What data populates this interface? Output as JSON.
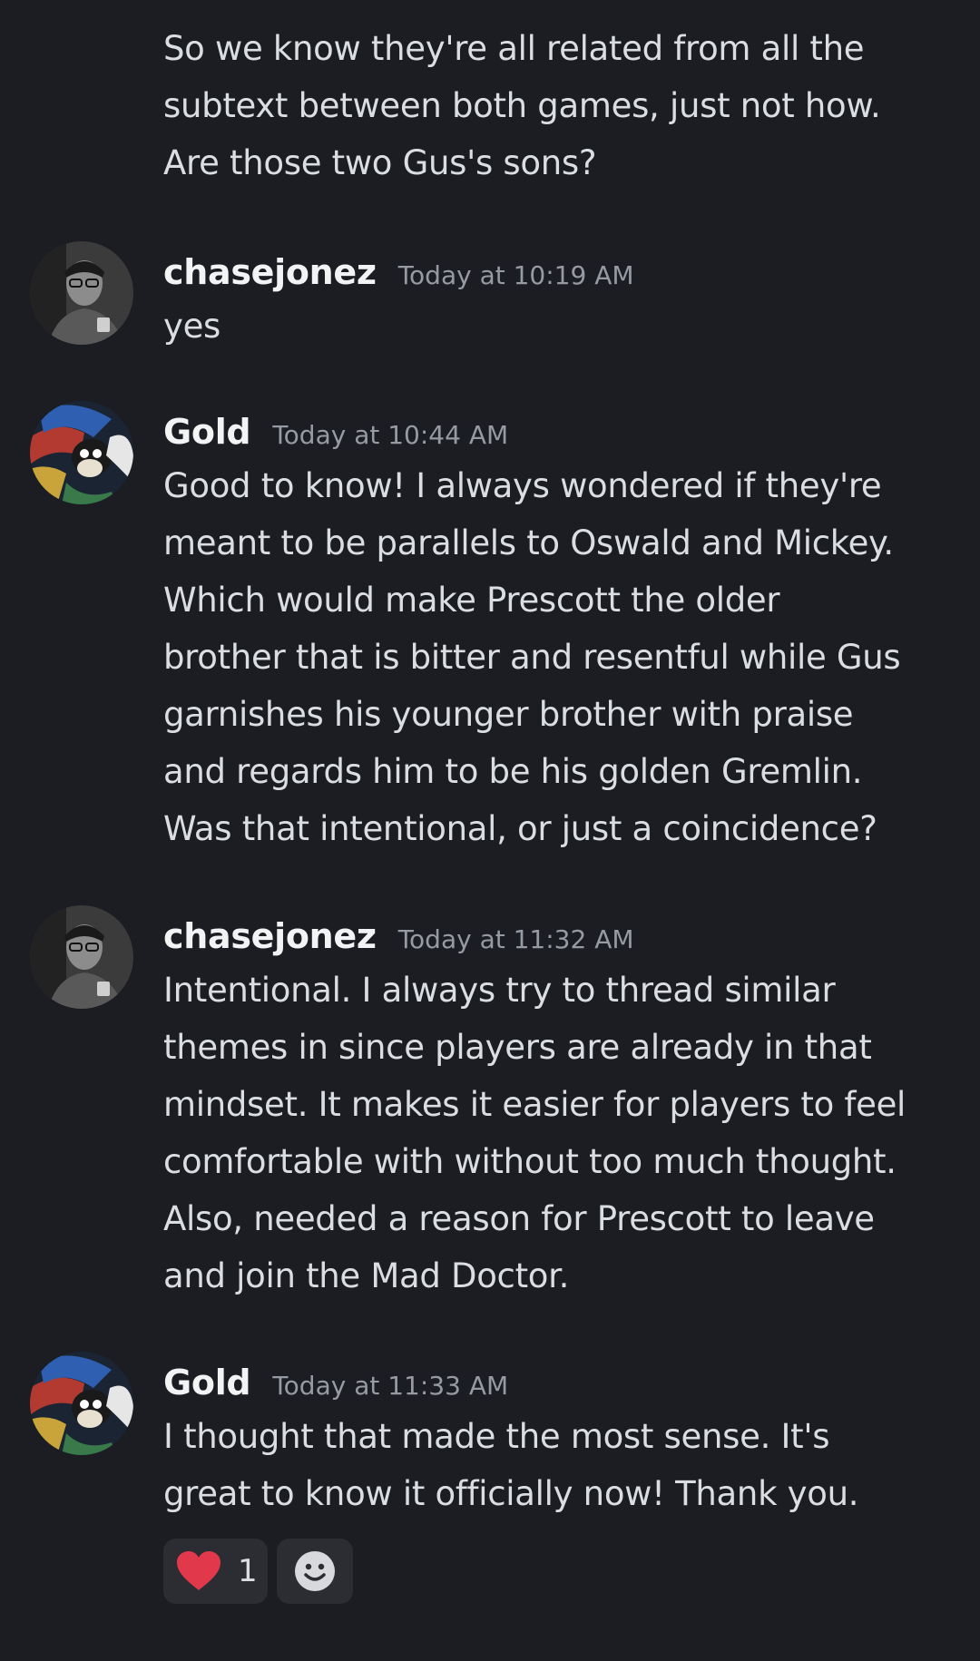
{
  "continuation": {
    "lines": [
      "So we know they're all related from all the",
      "subtext between both games, just not how.",
      "Are those two Gus's sons?"
    ]
  },
  "messages": [
    {
      "username": "chasejonez",
      "timestamp": "Today at 10:19 AM",
      "avatar": "man-with-glasses-avatar",
      "lines": [
        "yes"
      ]
    },
    {
      "username": "Gold",
      "timestamp": "Today at 10:44 AM",
      "avatar": "cartoon-rabbit-avatar",
      "lines": [
        "Good to know! I always wondered if they're",
        "meant to be parallels to Oswald and Mickey.",
        "Which would make Prescott the older",
        "brother that is bitter and resentful while Gus",
        "garnishes his younger brother with praise",
        "and regards him to be his golden Gremlin.",
        "Was that intentional, or just a coincidence?"
      ]
    },
    {
      "username": "chasejonez",
      "timestamp": "Today at 11:32 AM",
      "avatar": "man-with-glasses-avatar",
      "lines": [
        "Intentional. I always try to thread similar",
        "themes in since players are already in that",
        "mindset. It makes it easier for players to feel",
        "comfortable with without too much thought.",
        "Also, needed a reason for Prescott to leave",
        "and join the Mad Doctor."
      ]
    },
    {
      "username": "Gold",
      "timestamp": "Today at 11:33 AM",
      "avatar": "cartoon-rabbit-avatar",
      "lines": [
        "I thought that made the most sense. It's",
        "great to know it officially now! Thank you."
      ]
    }
  ],
  "reactions": {
    "heart": {
      "icon": "heart-icon",
      "count": "1",
      "color": "#e2384c"
    },
    "add": {
      "icon": "add-reaction-icon"
    }
  },
  "colors": {
    "background": "#1c1d22",
    "username": "#f2f3f5",
    "timestamp": "#969aa3",
    "text": "#dbdee1",
    "reaction_bg": "#2b2d33"
  }
}
